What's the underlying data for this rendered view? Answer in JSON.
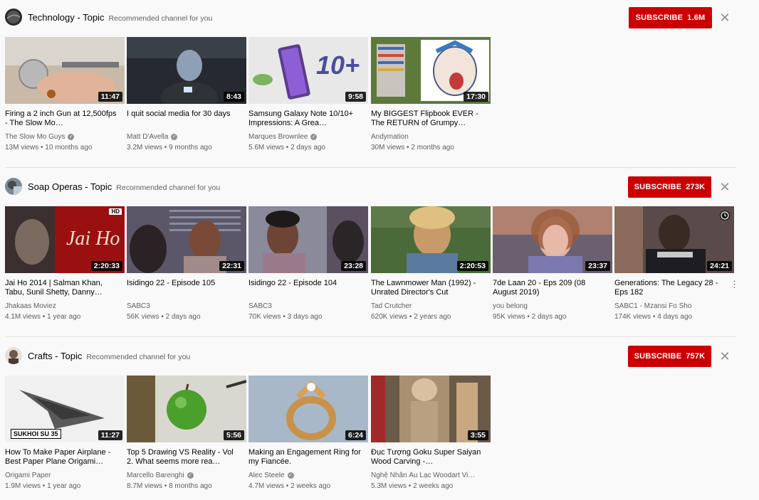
{
  "sections": [
    {
      "title": "Technology - Topic",
      "subtitle": "Recommended channel for you",
      "subscribe_label": "SUBSCRIBE",
      "subscribe_count": "1.6M",
      "videos": [
        {
          "title": "Firing a 2 inch Gun at 12,500fps - The Slow Mo…",
          "channel": "The Slow Mo Guys",
          "verified": true,
          "meta": "13M views • 10 months ago",
          "duration": "11:47"
        },
        {
          "title": "I quit social media for 30 days",
          "channel": "Matt D'Avella",
          "verified": true,
          "meta": "3.2M views • 9 months ago",
          "duration": "8:43"
        },
        {
          "title": "Samsung Galaxy Note 10/10+ Impressions: A Grea…",
          "channel": "Marques Brownlee",
          "verified": true,
          "meta": "5.6M views • 2 days ago",
          "duration": "9:58"
        },
        {
          "title": "My BIGGEST Flipbook EVER - The RETURN of Grumpy…",
          "channel": "Andymation",
          "verified": false,
          "meta": "30M views • 2 months ago",
          "duration": "17:30"
        }
      ]
    },
    {
      "title": "Soap Operas - Topic",
      "subtitle": "Recommended channel for you",
      "subscribe_label": "SUBSCRIBE",
      "subscribe_count": "273K",
      "videos": [
        {
          "title": "Jai Ho 2014 | Salman Khan, Tabu, Sunil Shetty, Danny…",
          "channel": "Jhakaas Moviez",
          "verified": false,
          "meta": "4.1M views • 1 year ago",
          "duration": "2:20:33",
          "hd": "HD"
        },
        {
          "title": "Isidingo 22 - Episode 105",
          "channel": "SABC3",
          "verified": false,
          "meta": "56K views • 2 days ago",
          "duration": "22:31"
        },
        {
          "title": "Isidingo 22 - Episode 104",
          "channel": "SABC3",
          "verified": false,
          "meta": "70K views • 3 days ago",
          "duration": "23:28"
        },
        {
          "title": "The Lawnmower Man (1992) - Unrated Director's Cut",
          "channel": "Tad Crutcher",
          "verified": false,
          "meta": "620K views • 2 years ago",
          "duration": "2:20:53"
        },
        {
          "title": "7de Laan 20 - Eps 209 (08 August 2019)",
          "channel": "you belong",
          "verified": false,
          "meta": "95K views • 2 days ago",
          "duration": "23:37"
        },
        {
          "title": "Generations: The Legacy 28 - Eps 182",
          "channel": "SABC1 - Mzansi Fo Sho",
          "verified": false,
          "meta": "174K views • 4 days ago",
          "duration": "24:21"
        }
      ]
    },
    {
      "title": "Crafts - Topic",
      "subtitle": "Recommended channel for you",
      "subscribe_label": "SUBSCRIBE",
      "subscribe_count": "757K",
      "videos": [
        {
          "title": "How To Make Paper Airplane - Best Paper Plane Origami…",
          "channel": "Origami Paper",
          "verified": false,
          "meta": "1.9M views • 1 year ago",
          "duration": "11:27",
          "thumb_text": "SUKHOI SU 35"
        },
        {
          "title": "Top 5 Drawing VS Reality - Vol 2. What seems more rea…",
          "channel": "Marcello Barenghi",
          "verified": true,
          "meta": "8.7M views • 8 months ago",
          "duration": "5:56"
        },
        {
          "title": "Making an Engagement Ring for my Fiancée.",
          "channel": "Alec Steele",
          "verified": true,
          "meta": "4.7M views • 2 weeks ago",
          "duration": "6:24"
        },
        {
          "title": "Đục Tượng Goku Super Saiyan Wood Carving -…",
          "channel": "Nghệ Nhân Âu Lạc Woodart Vi…",
          "verified": false,
          "meta": "5.3M views • 2 weeks ago",
          "duration": "3:55"
        }
      ]
    }
  ],
  "icons": {
    "close": "close-icon",
    "verified": "verified-check-icon",
    "more": "more-vert-icon",
    "watch_later": "clock-icon"
  },
  "colors": {
    "subscribe": "#cc0000",
    "background": "#f9f9f9",
    "secondary_text": "#606060"
  }
}
